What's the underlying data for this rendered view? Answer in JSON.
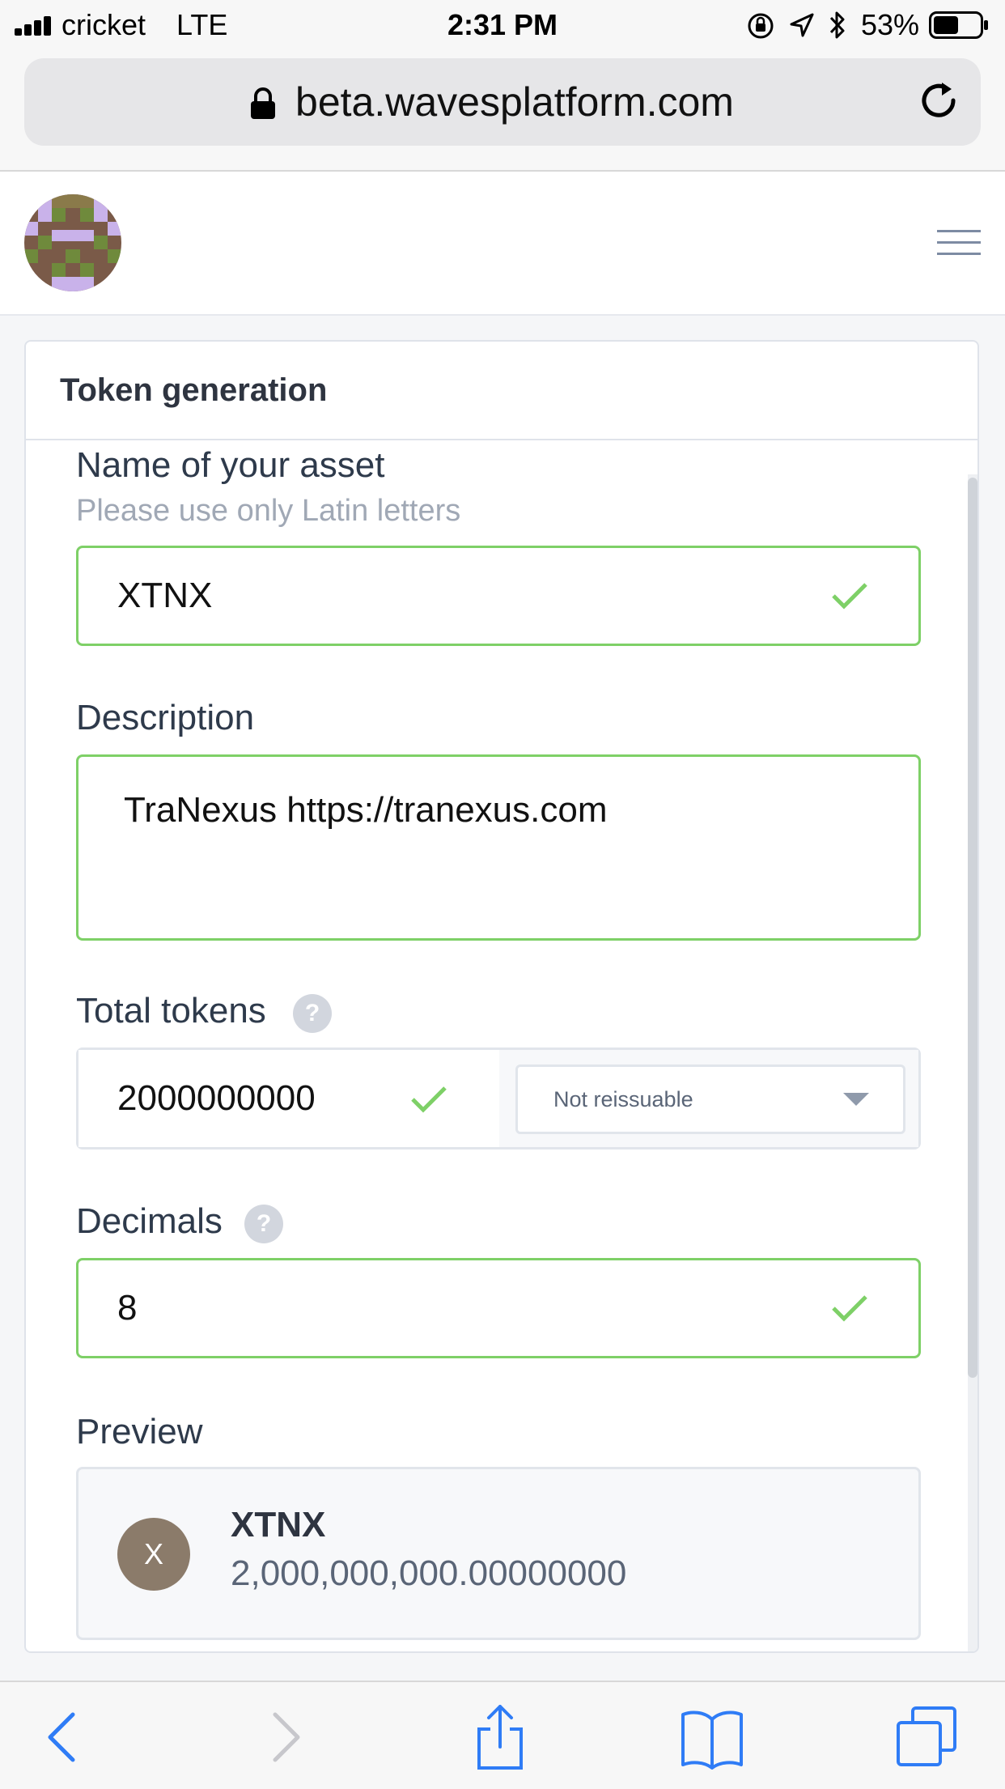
{
  "status_bar": {
    "carrier": "cricket",
    "network": "LTE",
    "time": "2:31 PM",
    "battery_percent": "53%",
    "battery_level": 0.53
  },
  "browser": {
    "url": "beta.wavesplatform.com"
  },
  "card": {
    "title": "Token generation"
  },
  "form": {
    "name_label": "Name of your asset",
    "name_hint": "Please use only Latin letters",
    "name_value": "XTNX",
    "description_label": "Description",
    "description_value": "TraNexus https://tranexus.com",
    "total_label": "Total tokens",
    "total_value": "2000000000",
    "reissuable_value": "Not reissuable",
    "decimals_label": "Decimals",
    "decimals_value": "8",
    "help_glyph": "?",
    "preview_label": "Preview"
  },
  "preview": {
    "avatar_letter": "X",
    "name": "XTNX",
    "amount": "2,000,000,000.00000000"
  },
  "colors": {
    "valid_border": "#7ed067",
    "browser_blue": "#2f7cf6"
  }
}
